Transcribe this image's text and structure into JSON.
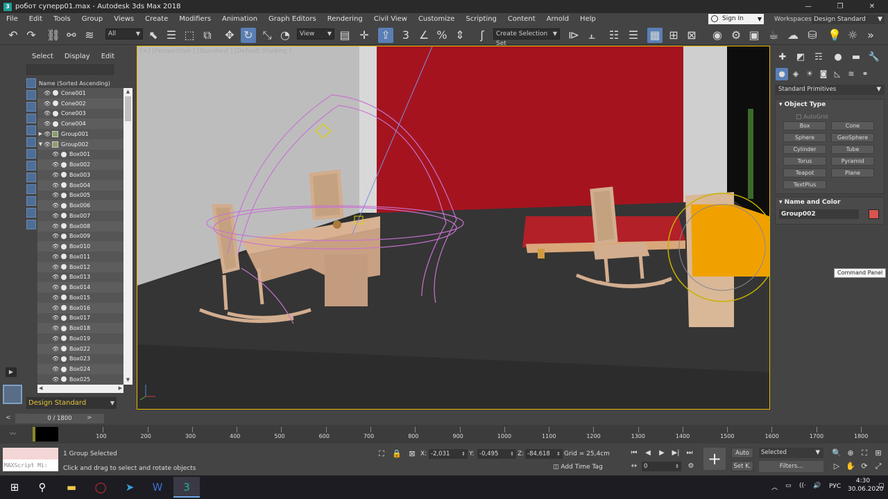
{
  "window": {
    "app_icon": "3",
    "title": "робот суперр01.max - Autodesk 3ds Max 2018",
    "controls": [
      "—",
      "❐",
      "✕"
    ]
  },
  "menu": [
    "File",
    "Edit",
    "Tools",
    "Group",
    "Views",
    "Create",
    "Modifiers",
    "Animation",
    "Graph Editors",
    "Rendering",
    "Civil View",
    "Customize",
    "Scripting",
    "Content",
    "Arnold",
    "Help"
  ],
  "account": {
    "signin": "Sign In",
    "workspaces_label": "Workspaces:",
    "workspace": "Design Standard"
  },
  "toolbar": {
    "filter": "All",
    "ref_coord": "View",
    "selection_set": "Create Selection Set"
  },
  "explorer": {
    "tabs": [
      "Select",
      "Display",
      "Edit"
    ],
    "column_header": "Name (Sorted Ascending)",
    "items": [
      {
        "name": "Cone001",
        "type": "object",
        "level": 0
      },
      {
        "name": "Cone002",
        "type": "object",
        "level": 0
      },
      {
        "name": "Cone003",
        "type": "object",
        "level": 0
      },
      {
        "name": "Cone004",
        "type": "object",
        "level": 0
      },
      {
        "name": "Group001",
        "type": "group",
        "level": 0,
        "expander": "▶"
      },
      {
        "name": "Group002",
        "type": "group",
        "level": 0,
        "expander": "▼"
      },
      {
        "name": "Box001",
        "type": "object",
        "level": 1
      },
      {
        "name": "Box002",
        "type": "object",
        "level": 1
      },
      {
        "name": "Box003",
        "type": "object",
        "level": 1
      },
      {
        "name": "Box004",
        "type": "object",
        "level": 1
      },
      {
        "name": "Box005",
        "type": "object",
        "level": 1
      },
      {
        "name": "Box006",
        "type": "object",
        "level": 1
      },
      {
        "name": "Box007",
        "type": "object",
        "level": 1
      },
      {
        "name": "Box008",
        "type": "object",
        "level": 1
      },
      {
        "name": "Box009",
        "type": "object",
        "level": 1
      },
      {
        "name": "Box010",
        "type": "object",
        "level": 1
      },
      {
        "name": "Box011",
        "type": "object",
        "level": 1
      },
      {
        "name": "Box012",
        "type": "object",
        "level": 1
      },
      {
        "name": "Box013",
        "type": "object",
        "level": 1
      },
      {
        "name": "Box014",
        "type": "object",
        "level": 1
      },
      {
        "name": "Box015",
        "type": "object",
        "level": 1
      },
      {
        "name": "Box016",
        "type": "object",
        "level": 1
      },
      {
        "name": "Box017",
        "type": "object",
        "level": 1
      },
      {
        "name": "Box018",
        "type": "object",
        "level": 1
      },
      {
        "name": "Box019",
        "type": "object",
        "level": 1
      },
      {
        "name": "Box022",
        "type": "object",
        "level": 1
      },
      {
        "name": "Box023",
        "type": "object",
        "level": 1
      },
      {
        "name": "Box024",
        "type": "object",
        "level": 1
      },
      {
        "name": "Box025",
        "type": "object",
        "level": 1
      }
    ],
    "workspace": "Design Standard"
  },
  "viewport": {
    "label": "[+] [Perspective ] [Standard ] [Default Shading ]",
    "wall_color": "#a5141e",
    "floor_color": "#353535",
    "accent": "#e6b800"
  },
  "command_panel": {
    "category": "Standard Primitives",
    "object_type_title": "Object Type",
    "autogrid": "AutoGrid",
    "buttons": [
      "Box",
      "Cone",
      "Sphere",
      "GeoSphere",
      "Cylinder",
      "Tube",
      "Torus",
      "Pyramid",
      "Teapot",
      "Plane",
      "TextPlus"
    ],
    "name_color_title": "Name and Color",
    "object_name": "Group002",
    "object_color": "#d9534f",
    "tooltip": "Command Panel"
  },
  "time": {
    "frame_display": "0 / 1800",
    "ticks": [
      "100",
      "200",
      "300",
      "400",
      "500",
      "600",
      "700",
      "800",
      "900",
      "1000",
      "1100",
      "1200",
      "1300",
      "1400",
      "1500",
      "1600",
      "1700",
      "1800"
    ]
  },
  "status": {
    "maxscript": "MAXScript Mi:",
    "selection": "1 Group Selected",
    "prompt": "Click and drag to select and rotate objects",
    "x_label": "X:",
    "x": "-2,031",
    "y_label": "Y:",
    "y": "-0,495",
    "z_label": "Z:",
    "z": "-84,618",
    "grid": "Grid = 25,4cm",
    "add_time_tag": "Add Time Tag",
    "frame": "0",
    "auto": "Auto",
    "setkey": "Set K.",
    "key_filter": "Selected",
    "filters": "Filters..."
  },
  "taskbar": {
    "lang": "РУС",
    "time": "4:30",
    "date": "30.06.2020"
  }
}
